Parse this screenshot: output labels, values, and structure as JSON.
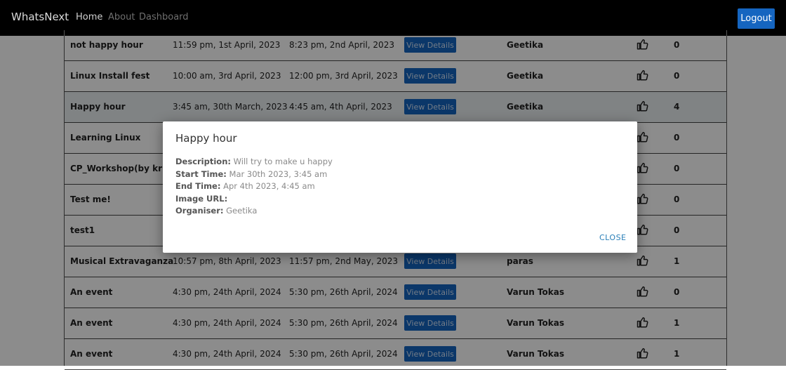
{
  "navbar": {
    "brand": "WhatsNext",
    "links": [
      "Home",
      "About",
      "Dashboard"
    ],
    "logout": "Logout"
  },
  "table": {
    "button_label": "View Details",
    "rows": [
      {
        "title": "not happy hour",
        "start": "11:59 pm, 1st April, 2023",
        "end": "8:23 pm, 2nd April, 2023",
        "organiser": "Geetika",
        "likes": "0"
      },
      {
        "title": "Linux Install fest",
        "start": "10:00 am, 3rd April, 2023",
        "end": "12:00 pm, 3rd April, 2023",
        "organiser": "Geetika",
        "likes": "0"
      },
      {
        "title": "Happy hour",
        "start": "3:45 am, 30th March, 2023",
        "end": "4:45 am, 4th April, 2023",
        "organiser": "Geetika",
        "likes": "4"
      },
      {
        "title": "Learning Linux",
        "start": "",
        "end": "",
        "organiser": "",
        "likes": "0"
      },
      {
        "title": "CP_Workshop(by krish)",
        "start": "",
        "end": "",
        "organiser": "",
        "likes": "0"
      },
      {
        "title": "Test me!",
        "start": "",
        "end": "",
        "organiser": "",
        "likes": "0"
      },
      {
        "title": "test1",
        "start": "",
        "end": "",
        "organiser": "",
        "likes": "0"
      },
      {
        "title": "Musical Extravaganza",
        "start": "10:57 pm, 8th April, 2023",
        "end": "11:57 pm, 2nd May, 2023",
        "organiser": "paras",
        "likes": "1"
      },
      {
        "title": "An event",
        "start": "4:30 pm, 24th April, 2024",
        "end": "5:30 pm, 26th April, 2024",
        "organiser": "Varun Tokas",
        "likes": "0"
      },
      {
        "title": "An event",
        "start": "4:30 pm, 24th April, 2024",
        "end": "5:30 pm, 26th April, 2024",
        "organiser": "Varun Tokas",
        "likes": "1"
      },
      {
        "title": "An event",
        "start": "4:30 pm, 24th April, 2024",
        "end": "5:30 pm, 26th April, 2024",
        "organiser": "Varun Tokas",
        "likes": "1"
      }
    ],
    "highlighted_row": 2
  },
  "modal": {
    "title": "Happy hour",
    "description_label": "Description:",
    "description_value": " Will try to make u happy",
    "start_label": "Start Time:",
    "start_value": " Mar 30th 2023, 3:45 am",
    "end_label": "End Time:",
    "end_value": " Apr 4th 2023, 4:45 am",
    "image_label": "Image URL:",
    "image_value": "",
    "organiser_label": "Organiser:",
    "organiser_value": " Geetika",
    "close": "CLOSE"
  },
  "icons": {
    "like": "thumbs-up-icon"
  },
  "colors": {
    "accent": "#1565c0",
    "navbar": "#000000",
    "link": "#2a7fb8"
  }
}
